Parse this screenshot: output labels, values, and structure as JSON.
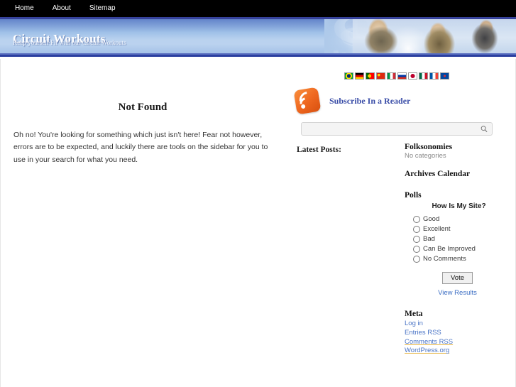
{
  "nav": {
    "items": [
      {
        "label": "Home",
        "name": "nav-item-home"
      },
      {
        "label": "About",
        "name": "nav-item-about"
      },
      {
        "label": "Sitemap",
        "name": "nav-item-sitemap"
      }
    ]
  },
  "banner": {
    "site_title": "Circuit Workouts",
    "tagline": "Keep yourself Fit with our Circuit Workouts"
  },
  "flags": [
    {
      "name": "flag-brazil",
      "title": "Portuguese (Brazil)",
      "colors": [
        "#009b3a",
        "#ffdf00",
        "#002776"
      ]
    },
    {
      "name": "flag-germany",
      "title": "German",
      "colors": [
        "#000000",
        "#dd0000",
        "#ffce00"
      ]
    },
    {
      "name": "flag-portugal",
      "title": "Portuguese",
      "colors": [
        "#006600",
        "#ff0000",
        "#ffcc00"
      ]
    },
    {
      "name": "flag-china",
      "title": "Chinese",
      "colors": [
        "#de2910",
        "#ffde00",
        "#de2910"
      ]
    },
    {
      "name": "flag-italy",
      "title": "Italian",
      "colors": [
        "#009246",
        "#ffffff",
        "#ce2b37"
      ]
    },
    {
      "name": "flag-russia",
      "title": "Russian",
      "colors": [
        "#ffffff",
        "#0039a6",
        "#d52b1e"
      ]
    },
    {
      "name": "flag-japan",
      "title": "Japanese",
      "colors": [
        "#ffffff",
        "#bc002d",
        "#ffffff"
      ]
    },
    {
      "name": "flag-mexico",
      "title": "Spanish (Mexico)",
      "colors": [
        "#006847",
        "#ffffff",
        "#ce1126"
      ]
    },
    {
      "name": "flag-france",
      "title": "French",
      "colors": [
        "#0055a4",
        "#ffffff",
        "#ef4135"
      ]
    },
    {
      "name": "flag-korea",
      "title": "Korean",
      "colors": [
        "#ffffff",
        "#cd2e3a",
        "#0047a0"
      ]
    }
  ],
  "main": {
    "title": "Not Found",
    "body": "Oh no! You're looking for something which just isn't here! Fear not however, errors are to be expected, and luckily there are tools on the sidebar for you to use in your search for what you need."
  },
  "sidebar": {
    "subscribe_label": "Subscribe In a Reader",
    "search": {
      "value": "",
      "placeholder": ""
    },
    "latest_posts_label": "Latest Posts:",
    "folksonomies": {
      "title": "Folksonomies",
      "empty": "No categories"
    },
    "archives": {
      "title": "Archives Calendar"
    },
    "polls": {
      "title": "Polls",
      "question": "How Is My Site?",
      "options": [
        "Good",
        "Excellent",
        "Bad",
        "Can Be Improved",
        "No Comments"
      ],
      "vote_label": "Vote",
      "view_results_label": "View Results"
    },
    "meta": {
      "title": "Meta",
      "links": [
        "Log in",
        "Entries RSS",
        "Comments RSS",
        "WordPress.org"
      ]
    }
  },
  "colors": {
    "nav_bg": "#000000",
    "banner_blue": "#9fc0e8",
    "banner_border": "#2b3fa0",
    "link_blue": "#4a74c6",
    "subscribe_blue": "#3b4ea8",
    "rss_orange": "#ef6820"
  }
}
